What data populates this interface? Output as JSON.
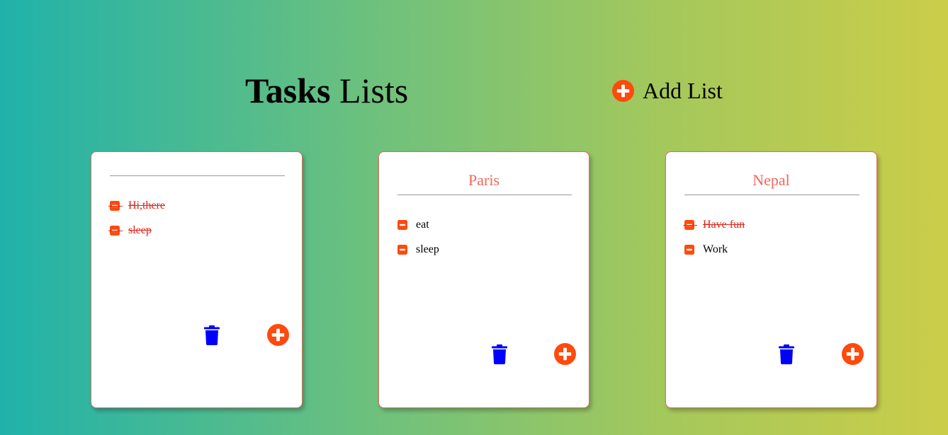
{
  "header": {
    "title_bold": "Tasks",
    "title_rest": "Lists",
    "add_list_label": "Add List"
  },
  "colors": {
    "accent": "#ff4a0d",
    "delete": "#0000ff",
    "done_text": "#e0241c",
    "list_title": "#f0675a"
  },
  "icons": {
    "add": "plus-circle-icon",
    "remove_task": "minus-square-icon",
    "delete_list": "trash-icon"
  },
  "lists": [
    {
      "title": "",
      "tasks": [
        {
          "text": "Hi,there",
          "done": true
        },
        {
          "text": "sleep",
          "done": true
        }
      ]
    },
    {
      "title": "Paris",
      "tasks": [
        {
          "text": "eat",
          "done": false
        },
        {
          "text": "sleep",
          "done": false
        }
      ]
    },
    {
      "title": "Nepal",
      "tasks": [
        {
          "text": "Have fun",
          "done": true
        },
        {
          "text": "Work",
          "done": false
        }
      ]
    }
  ]
}
